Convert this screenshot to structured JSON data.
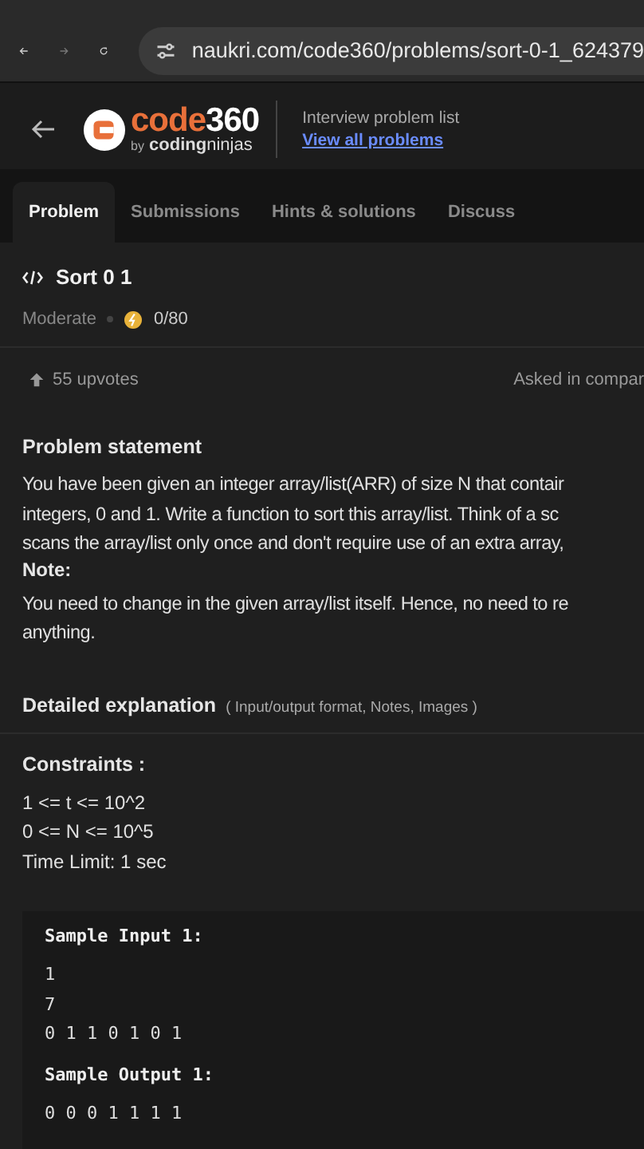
{
  "browser": {
    "url": "naukri.com/code360/problems/sort-0-1_624379"
  },
  "header": {
    "logo_main": "code",
    "logo_num": "360",
    "logo_by": "by",
    "logo_brand_bold": "coding",
    "logo_brand_light": "ninjas",
    "subtitle": "Interview problem list",
    "link": "View all problems"
  },
  "tabs": [
    {
      "label": "Problem",
      "selected": true
    },
    {
      "label": "Submissions",
      "selected": false
    },
    {
      "label": "Hints & solutions",
      "selected": false
    },
    {
      "label": "Discuss",
      "selected": false
    }
  ],
  "problem": {
    "title": "Sort 0 1",
    "difficulty": "Moderate",
    "score": "0/80",
    "upvotes": "55 upvotes",
    "asked_in": "Asked in compar"
  },
  "statement": {
    "heading": "Problem statement",
    "lines": [
      "You have been given an integer array/list(ARR) of size N that contair",
      "integers, 0 and 1. Write a function to sort this array/list. Think of a sc",
      "scans the array/list only once and don't require use of an extra array,"
    ],
    "note_label": "Note:",
    "note_lines": [
      "You need to change in the given array/list itself. Hence, no need to re",
      "anything."
    ]
  },
  "details": {
    "heading": "Detailed explanation",
    "hint": "( Input/output format, Notes, Images )"
  },
  "constraints": {
    "heading": "Constraints :",
    "lines": [
      "1 <= t <= 10^2",
      "0 <= N <= 10^5",
      "Time Limit: 1 sec"
    ]
  },
  "sample": {
    "input_heading": "Sample Input 1:",
    "input_lines": [
      "1",
      "7",
      "0 1 1 0 1 0 1"
    ],
    "output_heading": "Sample Output 1:",
    "output_lines": [
      "0 0 0 1 1 1 1"
    ]
  }
}
